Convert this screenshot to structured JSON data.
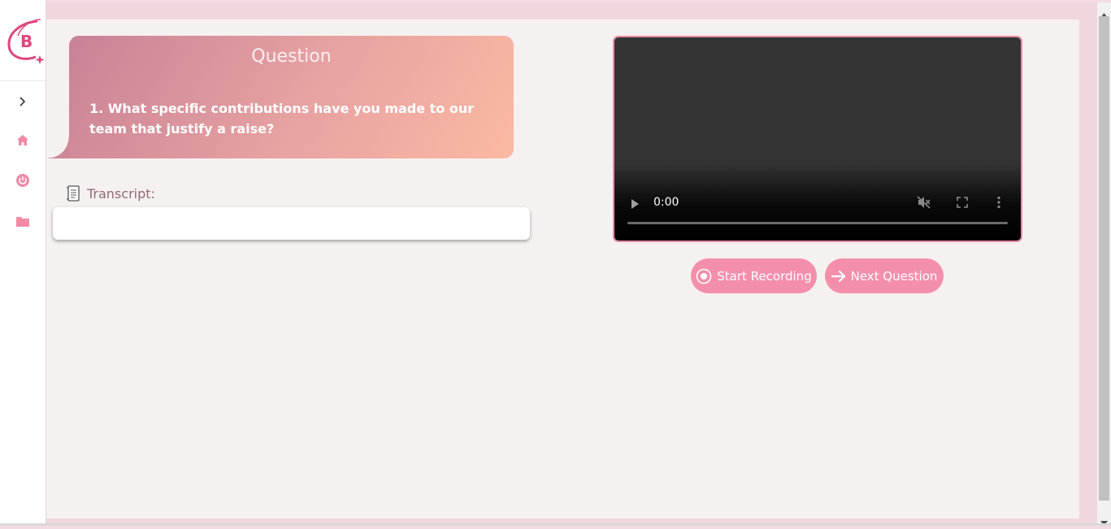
{
  "app": {
    "logo_icon": "b-logo",
    "accent_color": "#f48fab"
  },
  "sidebar": {
    "items": [
      {
        "icon": "chevron-right-icon"
      },
      {
        "icon": "home-icon"
      },
      {
        "icon": "power-icon"
      },
      {
        "icon": "folder-icon"
      }
    ]
  },
  "question": {
    "title": "Question",
    "text": "1. What specific contributions have you made to our team that justify a raise?"
  },
  "transcript": {
    "label": "Transcript:",
    "value": ""
  },
  "video": {
    "time": "0:00",
    "progress": 0
  },
  "actions": {
    "start_recording": "Start Recording",
    "next_question": "Next Question"
  }
}
